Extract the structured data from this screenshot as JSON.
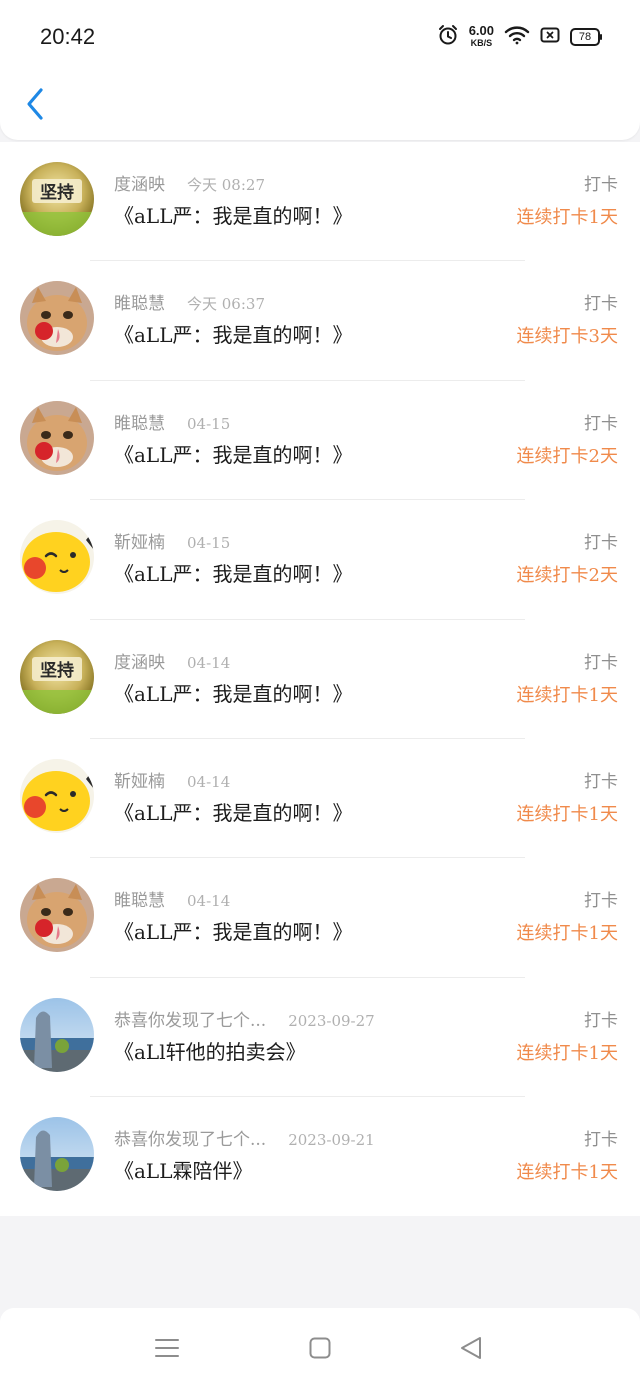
{
  "status_bar": {
    "time": "20:42",
    "net_speed_value": "6.00",
    "net_speed_unit": "KB/S",
    "battery": "78",
    "icons": [
      "alarm-icon",
      "wifi-icon",
      "sim-off-icon",
      "battery-icon"
    ]
  },
  "header": {
    "back_icon": "chevron-left-icon",
    "accent_color": "#1e88e5"
  },
  "colors": {
    "streak": "#f08a4b",
    "name": "#9a9a9a",
    "title": "#1d1d1d"
  },
  "items": [
    {
      "name": "度涵映",
      "time": "今天 08:27",
      "title": "《aLL严：我是直的啊！》",
      "action": "打卡",
      "streak": "连续打卡1天",
      "avatar": "jianchi-badge",
      "avatar_text": "坚持"
    },
    {
      "name": "睢聪慧",
      "time": "今天 06:37",
      "title": "《aLL严：我是直的啊！》",
      "action": "打卡",
      "streak": "连续打卡3天",
      "avatar": "cat-photo"
    },
    {
      "name": "睢聪慧",
      "time": "04-15",
      "title": "《aLL严：我是直的啊！》",
      "action": "打卡",
      "streak": "连续打卡2天",
      "avatar": "cat-photo"
    },
    {
      "name": "靳娅楠",
      "time": "04-15",
      "title": "《aLL严：我是直的啊！》",
      "action": "打卡",
      "streak": "连续打卡2天",
      "avatar": "pikachu-photo"
    },
    {
      "name": "度涵映",
      "time": "04-14",
      "title": "《aLL严：我是直的啊！》",
      "action": "打卡",
      "streak": "连续打卡1天",
      "avatar": "jianchi-badge",
      "avatar_text": "坚持"
    },
    {
      "name": "靳娅楠",
      "time": "04-14",
      "title": "《aLL严：我是直的啊！》",
      "action": "打卡",
      "streak": "连续打卡1天",
      "avatar": "pikachu-photo"
    },
    {
      "name": "睢聪慧",
      "time": "04-14",
      "title": "《aLL严：我是直的啊！》",
      "action": "打卡",
      "streak": "连续打卡1天",
      "avatar": "cat-photo"
    },
    {
      "name": "恭喜你发现了七个...",
      "time": "2023-09-27",
      "title": "《aLl轩他的拍卖会》",
      "action": "打卡",
      "streak": "连续打卡1天",
      "avatar": "landscape-photo"
    },
    {
      "name": "恭喜你发现了七个...",
      "time": "2023-09-21",
      "title": "《aLL霖陪伴》",
      "action": "打卡",
      "streak": "连续打卡1天",
      "avatar": "landscape-photo"
    }
  ],
  "nav": {
    "icons": [
      "menu-icon",
      "home-square-icon",
      "back-triangle-icon"
    ]
  }
}
